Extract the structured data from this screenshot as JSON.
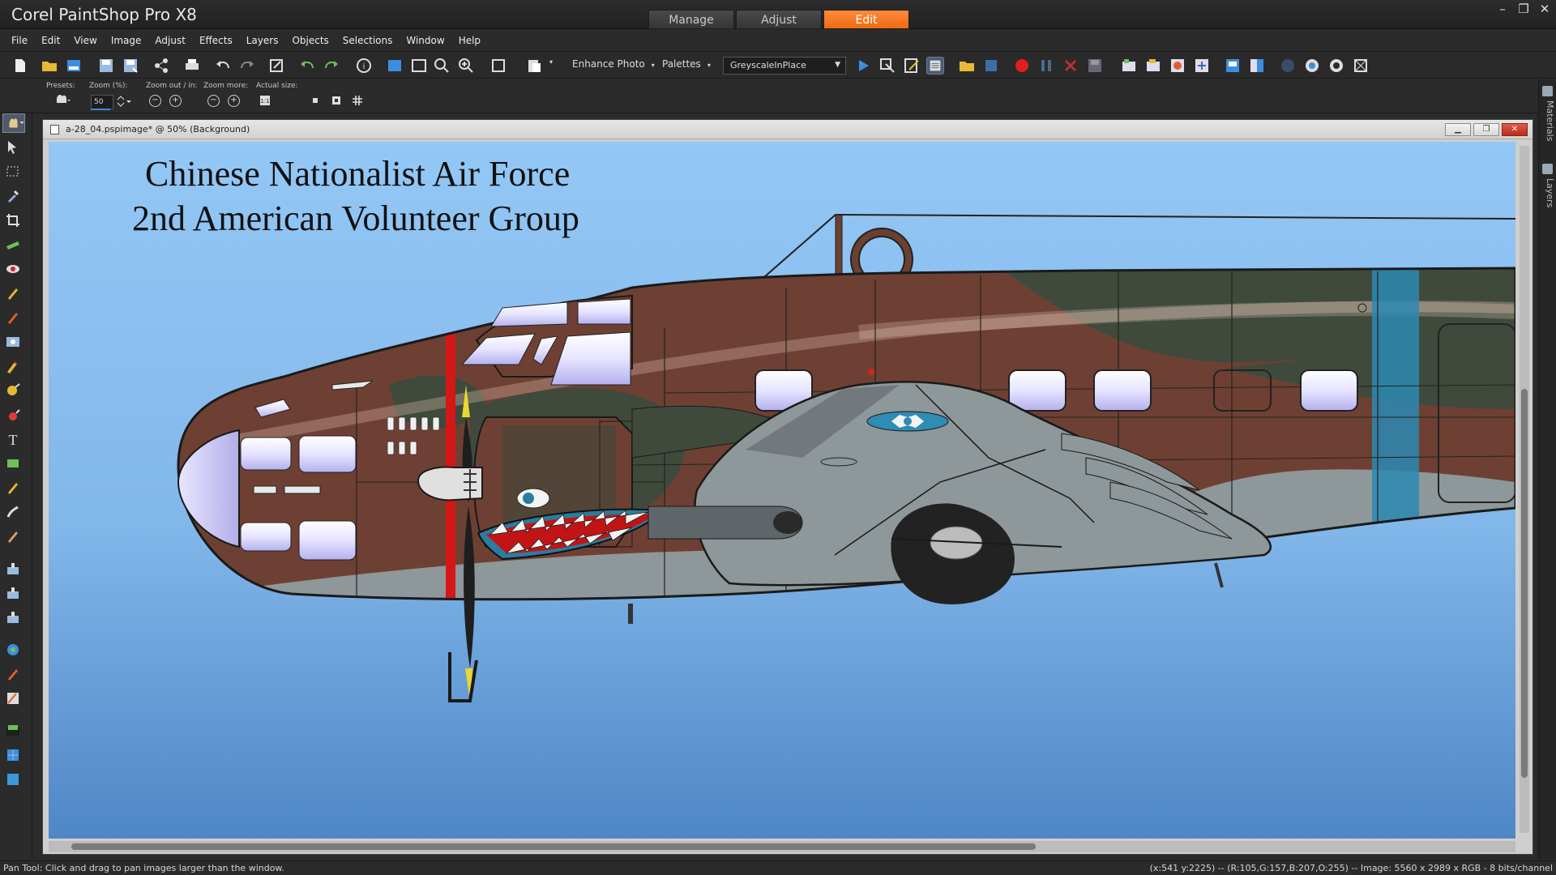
{
  "app": {
    "title": "Corel PaintShop Pro X8"
  },
  "workspace_tabs": [
    {
      "label": "Manage",
      "active": false
    },
    {
      "label": "Adjust",
      "active": false
    },
    {
      "label": "Edit",
      "active": true
    }
  ],
  "window_controls": {
    "minimize": "–",
    "restore": "❐",
    "close": "✕"
  },
  "menu": [
    "File",
    "Edit",
    "View",
    "Image",
    "Adjust",
    "Effects",
    "Layers",
    "Objects",
    "Selections",
    "Window",
    "Help"
  ],
  "toolbar": {
    "enhance_photo": "Enhance Photo",
    "palettes": "Palettes",
    "script_selected": "GreyscaleInPlace"
  },
  "tool_options": {
    "presets_label": "Presets:",
    "zoom_label": "Zoom (%):",
    "zoom_value": "50",
    "zoom_out_in_label": "Zoom out / in:",
    "zoom_more_label": "Zoom more:",
    "actual_size_label": "Actual size:"
  },
  "right_dock": {
    "materials": "Materials",
    "layers": "Layers"
  },
  "image_window": {
    "title": "a-28_04.pspimage* @  50% (Background)",
    "canvas_text_line1": "Chinese Nationalist Air Force",
    "canvas_text_line2": "2nd American Volunteer Group"
  },
  "status": {
    "left": "Pan Tool: Click and drag to pan images larger than the window.",
    "right": "(x:541 y:2225) -- (R:105,G:157,B:207,O:255) -- Image:  5560 x 2989 x RGB - 8 bits/channel"
  },
  "colors": {
    "accent_orange": "#f27a20",
    "sky_top": "#93c7f5",
    "sky_bottom": "#4f86c6",
    "camo_brown": "#6e4033",
    "camo_green": "#3f4a3c",
    "underside_grey": "#8e979a"
  }
}
